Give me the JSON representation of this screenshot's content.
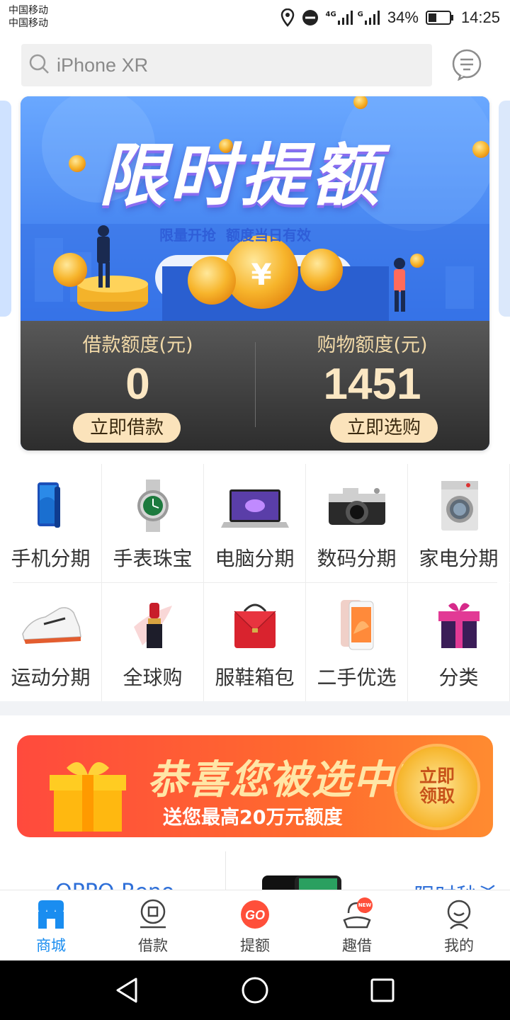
{
  "status_bar": {
    "carrier_1": "中国移动",
    "carrier_2": "中国移动",
    "network_1": "4G",
    "network_2": "G",
    "battery": "34%",
    "time": "14:25",
    "icons": [
      "location-icon",
      "do-not-disturb-icon",
      "signal-icon",
      "battery-icon"
    ]
  },
  "search": {
    "placeholder": "iPhone XR",
    "icon": "search-icon"
  },
  "header": {
    "message_icon": "message-icon"
  },
  "banner": {
    "title": "限时提额",
    "tagline_1": "限量开抢",
    "tagline_2": "额度当日有效",
    "colors": {
      "sky": "#3d86f2",
      "coin": "#f7b52c"
    }
  },
  "credit": {
    "loan_label": "借款额度(元)",
    "loan_value": "0",
    "loan_button": "立即借款",
    "shop_label": "购物额度(元)",
    "shop_value": "1451",
    "shop_button": "立即选购"
  },
  "categories": [
    {
      "label": "手机分期",
      "icon": "phone-icon"
    },
    {
      "label": "手表珠宝",
      "icon": "watch-icon"
    },
    {
      "label": "电脑分期",
      "icon": "laptop-icon"
    },
    {
      "label": "数码分期",
      "icon": "camera-icon"
    },
    {
      "label": "家电分期",
      "icon": "washing-machine-icon"
    },
    {
      "label": "运动分期",
      "icon": "sneaker-icon"
    },
    {
      "label": "全球购",
      "icon": "lipstick-icon"
    },
    {
      "label": "服鞋箱包",
      "icon": "handbag-icon"
    },
    {
      "label": "二手优选",
      "icon": "used-phone-icon"
    },
    {
      "label": "分类",
      "icon": "gift-box-icon"
    }
  ],
  "promo": {
    "title": "恭喜您被选中!",
    "subtitle": "送您最高20万元额度",
    "button": "立即领取",
    "icon": "gift-icon"
  },
  "peek": {
    "left": "OPPO Reno",
    "right": "限时秒杀"
  },
  "tabs": [
    {
      "label": "商城",
      "icon": "store-icon",
      "active": true
    },
    {
      "label": "借款",
      "icon": "loan-icon",
      "active": false
    },
    {
      "label": "提额",
      "icon": "go-icon",
      "active": false
    },
    {
      "label": "趣借",
      "icon": "fun-loan-icon",
      "active": false,
      "badge": "NEW"
    },
    {
      "label": "我的",
      "icon": "profile-icon",
      "active": false
    }
  ],
  "colors": {
    "accent": "#1a8df0",
    "credit_text": "#fbe7c3",
    "promo": "#ff5a34"
  }
}
